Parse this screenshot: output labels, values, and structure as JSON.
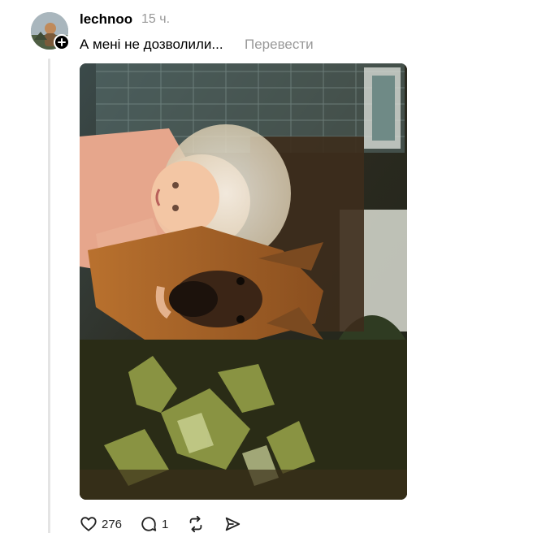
{
  "post": {
    "username": "lechnoo",
    "timestamp": "15 ч.",
    "text": "А мені не дозволили...",
    "translate_label": "Перевести",
    "avatar_icon": "user-avatar",
    "follow_icon": "plus-icon",
    "photo_description": "photo"
  },
  "actions": {
    "like_count": "276",
    "reply_count": "1",
    "like_icon": "heart-icon",
    "reply_icon": "comment-icon",
    "repost_icon": "repost-icon",
    "share_icon": "send-icon"
  },
  "colors": {
    "text": "#000000",
    "muted": "#999999",
    "thread_line": "#e4e4e4"
  }
}
